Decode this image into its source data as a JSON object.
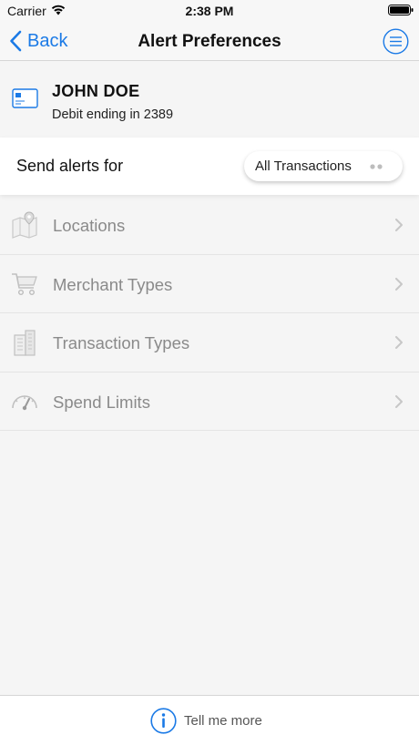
{
  "status_bar": {
    "carrier": "Carrier",
    "time": "2:38 PM",
    "icons": [
      "wifi-icon",
      "battery-icon"
    ]
  },
  "nav": {
    "back_label": "Back",
    "title": "Alert Preferences",
    "accent_color": "#1b7ae6",
    "icons": [
      "chevron-left-icon",
      "menu-icon"
    ]
  },
  "account": {
    "name": "JOHN DOE",
    "subtitle": "Debit ending in 2389",
    "icon": "card-icon"
  },
  "alerts": {
    "label": "Send alerts for",
    "selected_value": "All Transactions"
  },
  "preferences": [
    {
      "label": "Locations",
      "icon": "map-pin-icon"
    },
    {
      "label": "Merchant Types",
      "icon": "cart-icon"
    },
    {
      "label": "Transaction Types",
      "icon": "building-icon"
    },
    {
      "label": "Spend Limits",
      "icon": "gauge-icon"
    }
  ],
  "footer": {
    "label": "Tell me more",
    "icon": "info-icon"
  }
}
